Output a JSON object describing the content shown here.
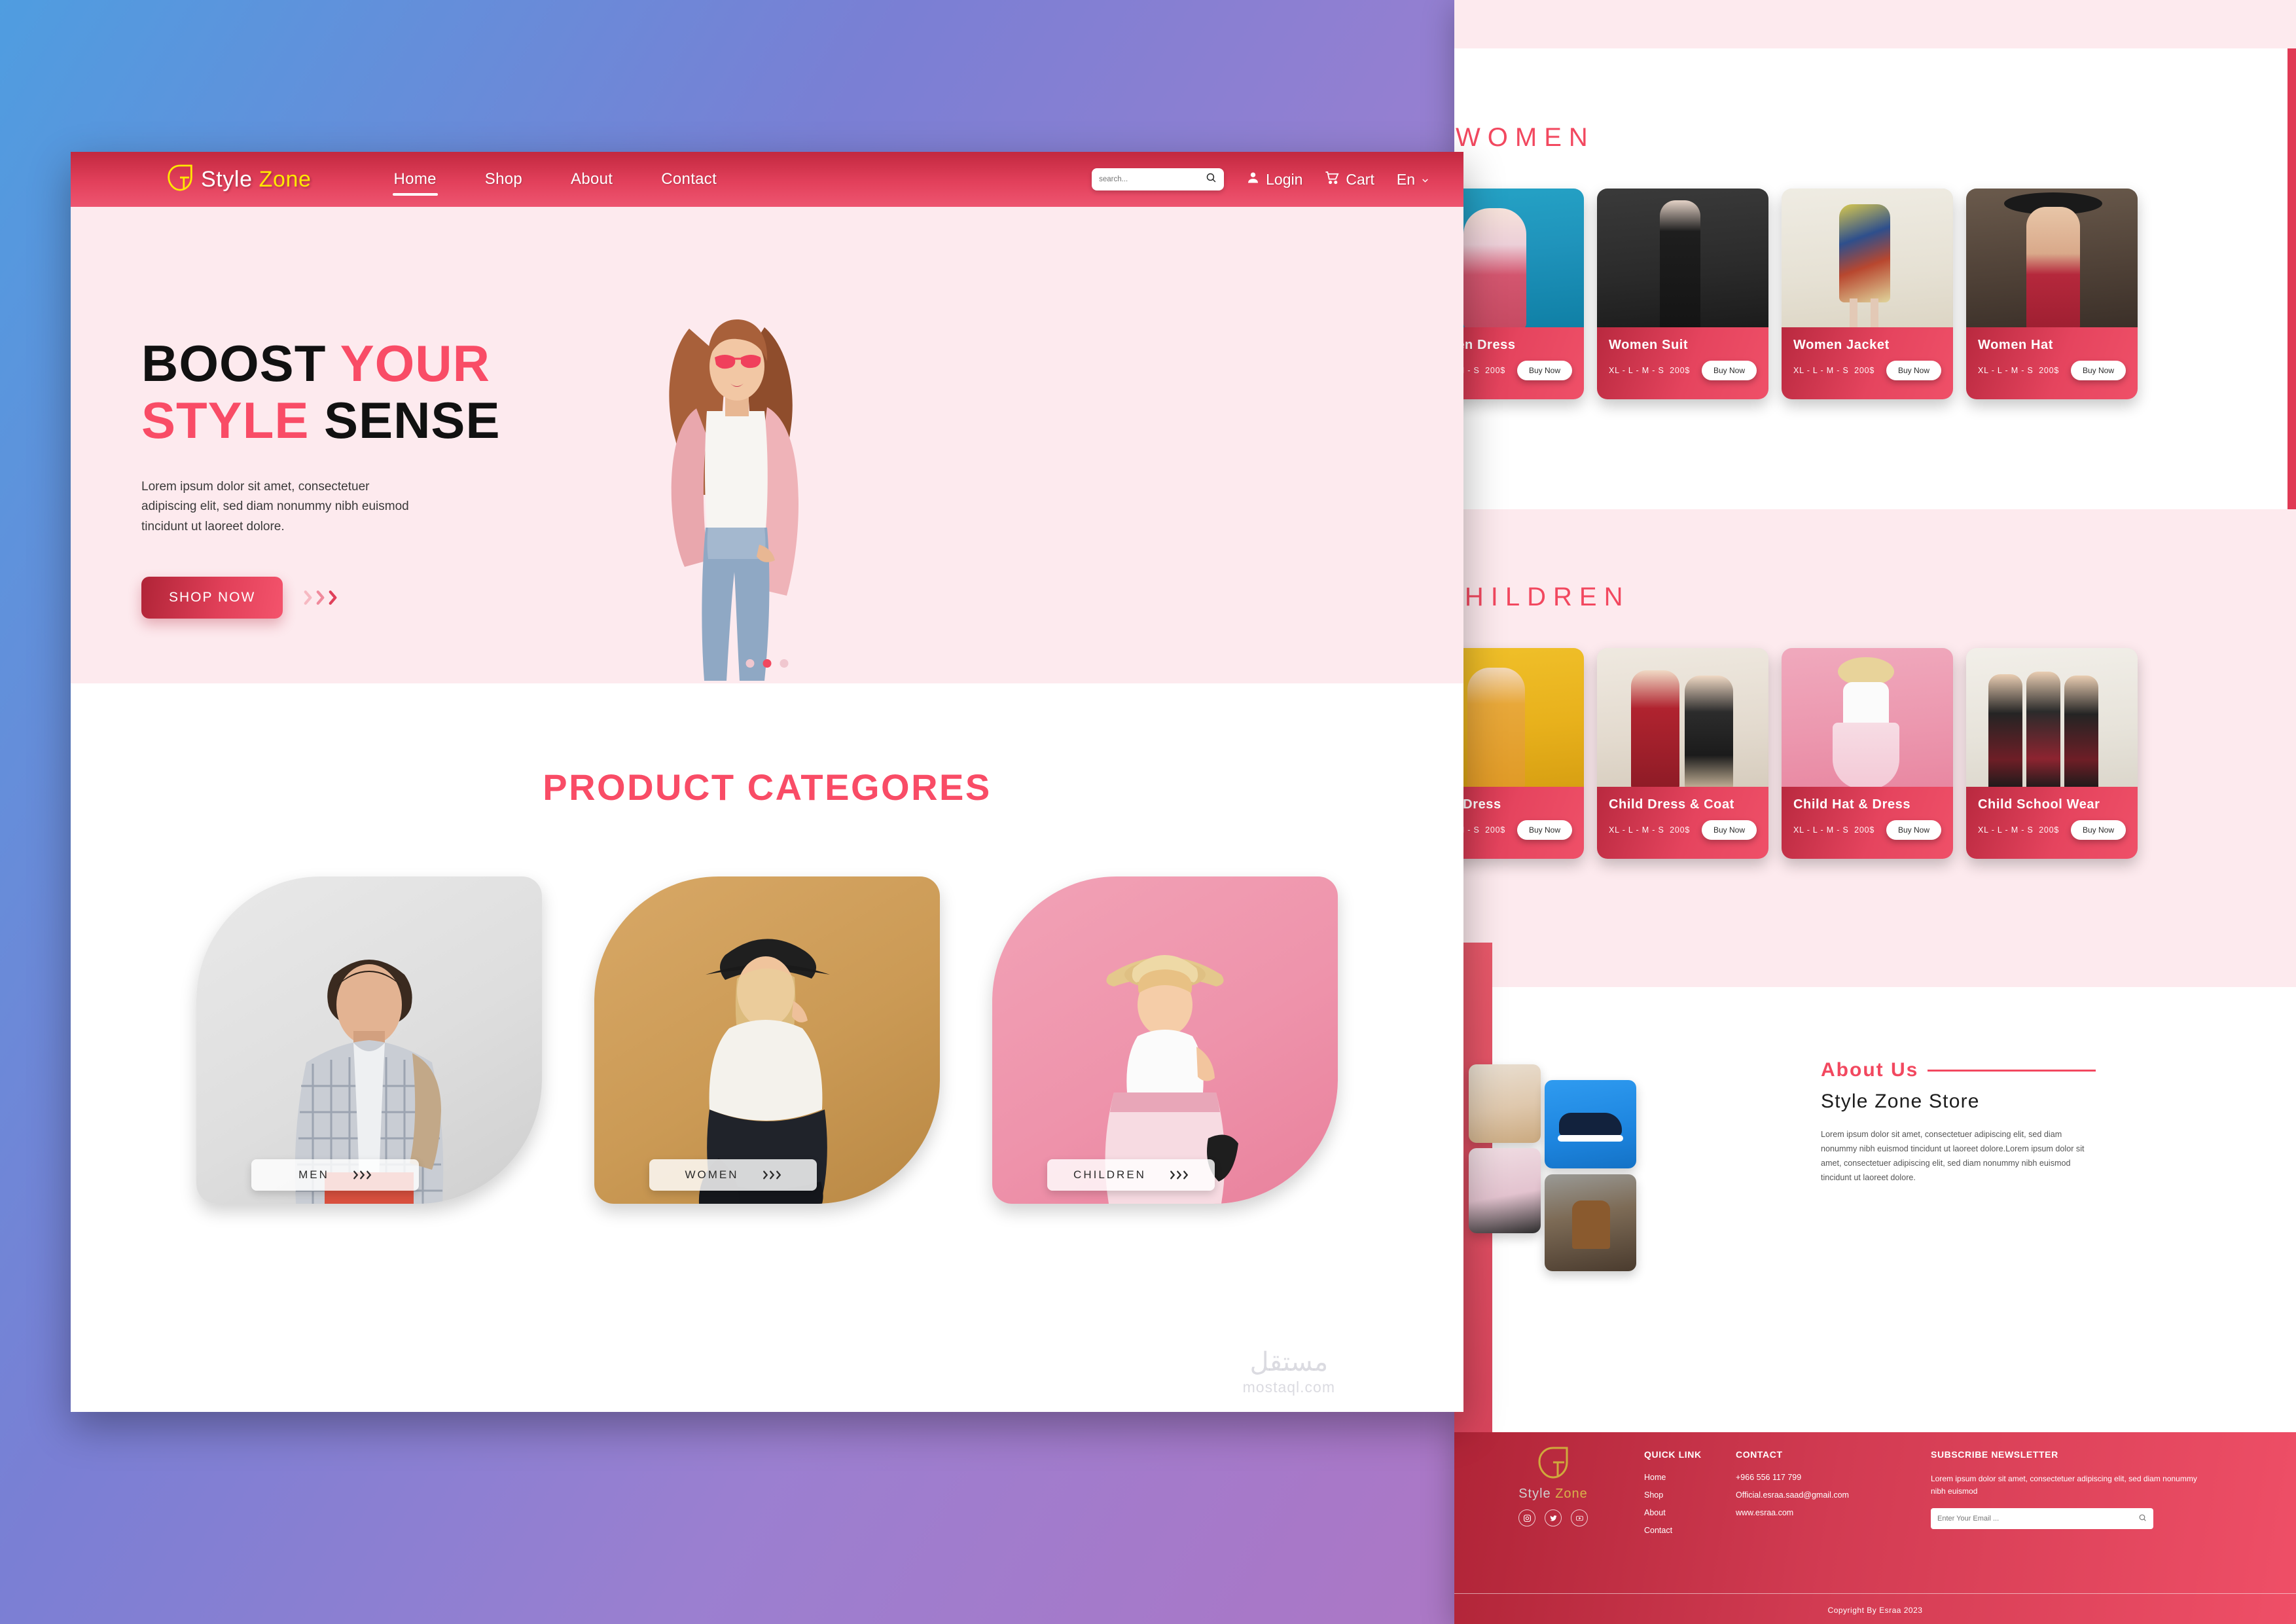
{
  "brand": {
    "name_part1": "Style",
    "name_part2": "Zone",
    "logo_icon": "style-zone-logo-icon"
  },
  "nav": {
    "links": [
      {
        "label": "Home",
        "active": true
      },
      {
        "label": "Shop",
        "active": false
      },
      {
        "label": "About",
        "active": false
      },
      {
        "label": "Contact",
        "active": false
      }
    ],
    "search": {
      "placeholder": "search...",
      "value": "",
      "icon": "search-icon"
    },
    "login": {
      "label": "Login",
      "icon": "user-icon"
    },
    "cart": {
      "label": "Cart",
      "icon": "shopping-cart-icon"
    },
    "language": {
      "label": "En",
      "icon": "chevron-down-icon"
    }
  },
  "hero": {
    "line1_a": "BOOST ",
    "line1_b": "YOUR",
    "line2_a": "STYLE ",
    "line2_b": "SENSE",
    "paragraph": "Lorem ipsum dolor sit amet, consectetuer adipiscing elit, sed diam nonummy nibh euismod tincidunt ut laoreet dolore.",
    "cta_label": "SHOP NOW",
    "arrow_icon": "double-chevron-right-icon",
    "slider_dots": 3,
    "active_dot_index": 1
  },
  "categories": {
    "title": "PRODUCT CATEGORES",
    "items": [
      {
        "label": "MEN",
        "arrow_icon": "chevron-right-icon"
      },
      {
        "label": "WOMEN",
        "arrow_icon": "chevron-right-icon"
      },
      {
        "label": "CHILDREN",
        "arrow_icon": "chevron-right-icon"
      }
    ]
  },
  "watermark": {
    "arabic": "مستقل",
    "latin": "mostaql.com"
  },
  "women_section": {
    "heading": "WOMEN",
    "products": [
      {
        "name": "Women Dress",
        "sizes": "XL - L - M - S",
        "price": "200$",
        "buy_label": "Buy Now"
      },
      {
        "name": "Women Suit",
        "sizes": "XL - L - M - S",
        "price": "200$",
        "buy_label": "Buy Now"
      },
      {
        "name": "Women Jacket",
        "sizes": "XL - L - M - S",
        "price": "200$",
        "buy_label": "Buy Now"
      },
      {
        "name": "Women Hat",
        "sizes": "XL - L - M - S",
        "price": "200$",
        "buy_label": "Buy Now"
      }
    ]
  },
  "children_section": {
    "heading": "CHILDREN",
    "products": [
      {
        "name": "Child Dress",
        "sizes": "XL - L - M - S",
        "price": "200$",
        "buy_label": "Buy Now"
      },
      {
        "name": "Child Dress & Coat",
        "sizes": "XL - L - M - S",
        "price": "200$",
        "buy_label": "Buy Now"
      },
      {
        "name": "Child Hat & Dress",
        "sizes": "XL - L - M - S",
        "price": "200$",
        "buy_label": "Buy Now"
      },
      {
        "name": "Child School Wear",
        "sizes": "XL - L - M - S",
        "price": "200$",
        "buy_label": "Buy Now"
      }
    ]
  },
  "about": {
    "title": "About Us",
    "subtitle": "Style Zone Store",
    "text": "Lorem ipsum dolor sit amet, consectetuer adipiscing elit, sed diam nonummy nibh euismod tincidunt ut laoreet dolore.Lorem ipsum dolor sit amet, consectetuer adipiscing elit, sed diam nonummy nibh euismod tincidunt ut laoreet dolore."
  },
  "footer": {
    "brand_part1": "Style",
    "brand_part2": "Zone",
    "social": [
      {
        "name": "instagram-icon",
        "glyph": "◉"
      },
      {
        "name": "twitter-icon",
        "glyph": "🐦"
      },
      {
        "name": "youtube-icon",
        "glyph": "▶"
      }
    ],
    "quick_link": {
      "title": "QUICK LINK",
      "items": [
        "Home",
        "Shop",
        "About",
        "Contact"
      ]
    },
    "contact": {
      "title": "CONTACT",
      "items": [
        "+966 556 117 799",
        "Official.esraa.saad@gmail.com",
        "www.esraa.com"
      ]
    },
    "newsletter": {
      "title": "SUBSCRIBE NEWSLETTER",
      "text": "Lorem ipsum dolor sit amet, consectetuer adipiscing elit, sed diam nonummy nibh euismod",
      "placeholder": "Enter Your Email ...",
      "submit_icon": "search-icon"
    },
    "copyright": "Copyright By Esraa 2023"
  },
  "colors": {
    "primary_pink": "#f94c66",
    "deep_red": "#b02437",
    "accent_yellow": "#ffe800",
    "soft_pink_bg": "#fdeaee"
  }
}
